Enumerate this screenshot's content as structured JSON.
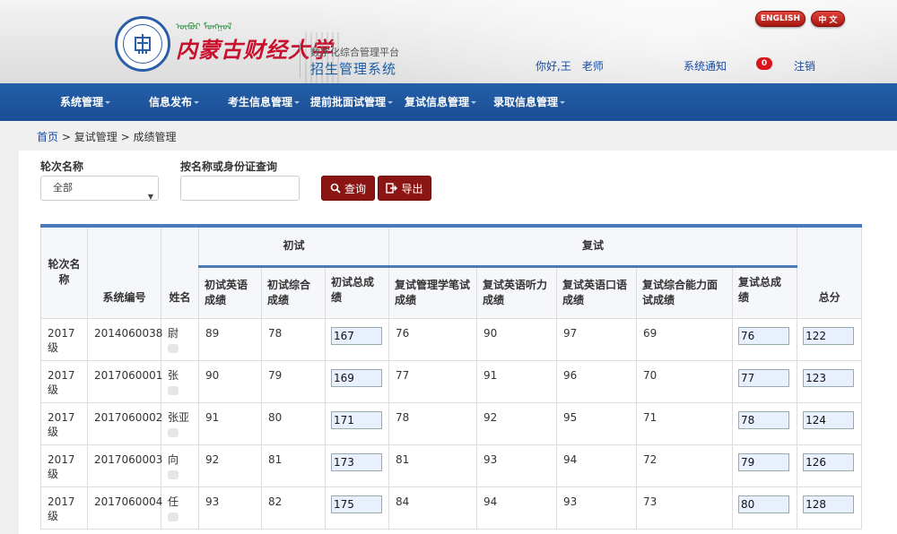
{
  "header": {
    "mongol_text": "ᠥᠪᠦᠷ ᠮᠣᠩᠭᠣᠯ",
    "university": "内蒙古财经大学",
    "platform": "数字化综合管理平台",
    "system": "招生管理系统",
    "lang_en": "ENGLISH",
    "lang_cn": "中 文",
    "greeting": "你好,王　老师",
    "notice": "系统通知",
    "notice_count": "0",
    "logout": "注销"
  },
  "nav": [
    {
      "label": "系统管理"
    },
    {
      "label": "信息发布"
    },
    {
      "label": "考生信息管理"
    },
    {
      "label": "提前批面试管理"
    },
    {
      "label": "复试信息管理"
    },
    {
      "label": "录取信息管理"
    }
  ],
  "breadcrumb": {
    "home": "首页",
    "sep": ">",
    "level1": "复试管理",
    "level2": "成绩管理"
  },
  "filters": {
    "round_label": "轮次名称",
    "round_value": "全部",
    "search_label": "按名称或身份证查询",
    "search_value": "",
    "query_button": "查询",
    "export_button": "导出"
  },
  "table": {
    "group_initial": "初试",
    "group_retest": "复试",
    "headers": {
      "round": "轮次名称",
      "sys_no": "系统编号",
      "name": "姓名",
      "init_en": "初试英语成绩",
      "init_comp": "初试综合成绩",
      "init_total": "初试总成绩",
      "re_mgmt": "复试管理学笔试成绩",
      "re_listen": "复试英语听力成绩",
      "re_oral": "复试英语口语成绩",
      "re_ability": "复试综合能力面试成绩",
      "re_total": "复试总成绩",
      "total": "总分"
    },
    "rows": [
      {
        "round": "2017级",
        "sys_no": "2014060038",
        "name": "尉",
        "init_en": "89",
        "init_comp": "78",
        "init_total": "167",
        "re_mgmt": "76",
        "re_listen": "90",
        "re_oral": "97",
        "re_ability": "69",
        "re_total": "76",
        "total": "122"
      },
      {
        "round": "2017级",
        "sys_no": "2017060001",
        "name": "张",
        "init_en": "90",
        "init_comp": "79",
        "init_total": "169",
        "re_mgmt": "77",
        "re_listen": "91",
        "re_oral": "96",
        "re_ability": "70",
        "re_total": "77",
        "total": "123"
      },
      {
        "round": "2017级",
        "sys_no": "2017060002",
        "name": "张亚",
        "init_en": "91",
        "init_comp": "80",
        "init_total": "171",
        "re_mgmt": "78",
        "re_listen": "92",
        "re_oral": "95",
        "re_ability": "71",
        "re_total": "78",
        "total": "124"
      },
      {
        "round": "2017级",
        "sys_no": "2017060003",
        "name": "向",
        "init_en": "92",
        "init_comp": "81",
        "init_total": "173",
        "re_mgmt": "81",
        "re_listen": "93",
        "re_oral": "94",
        "re_ability": "72",
        "re_total": "79",
        "total": "126"
      },
      {
        "round": "2017级",
        "sys_no": "2017060004",
        "name": "任",
        "init_en": "93",
        "init_comp": "82",
        "init_total": "175",
        "re_mgmt": "84",
        "re_listen": "94",
        "re_oral": "93",
        "re_ability": "73",
        "re_total": "80",
        "total": "128"
      }
    ]
  },
  "colors": {
    "nav_bg": "#1a4e94",
    "accent_red": "#8b1512",
    "link_blue": "#1a4aa0",
    "table_top": "#4a7ab8"
  }
}
